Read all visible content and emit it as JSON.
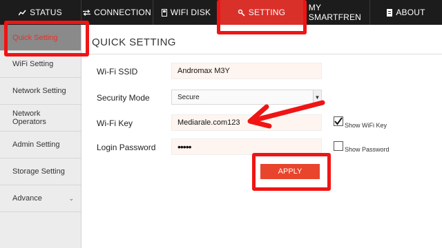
{
  "nav": {
    "tabs": [
      {
        "label": "STATUS",
        "icon": "chart-icon"
      },
      {
        "label": "CONNECTION",
        "icon": "arrows-icon"
      },
      {
        "label": "WIFI DISK",
        "icon": "disk-icon"
      },
      {
        "label": "SETTING",
        "icon": "gear-icon"
      },
      {
        "label": "MY SMARTFREN",
        "icon": "divider-icon"
      },
      {
        "label": "ABOUT",
        "icon": "doc-icon"
      }
    ],
    "active": "SETTING"
  },
  "sidebar": {
    "items": [
      {
        "label": "Quick Setting"
      },
      {
        "label": "WiFi Setting"
      },
      {
        "label": "Network Setting"
      },
      {
        "label": "Network Operators"
      },
      {
        "label": "Admin Setting"
      },
      {
        "label": "Storage Setting"
      },
      {
        "label": "Advance"
      }
    ]
  },
  "main": {
    "title": "QUICK SETTING",
    "labels": {
      "ssid": "Wi-Fi SSID",
      "security": "Security Mode",
      "key": "Wi-Fi Key",
      "login": "Login Password"
    },
    "values": {
      "ssid": "Andromax M3Y",
      "security": "Secure",
      "key": "Mediarale.com123",
      "login": "•••••"
    },
    "show_wifi_key": {
      "label": "Show WiFi Key",
      "checked": true
    },
    "show_password": {
      "label": "Show Password",
      "checked": false
    },
    "apply_label": "APPLY"
  },
  "colors": {
    "accent": "#d9302a",
    "annotation": "#f01414",
    "button": "#e8452c",
    "nav_bg": "#1c1c1c",
    "sidebar_bg": "#ececec"
  }
}
